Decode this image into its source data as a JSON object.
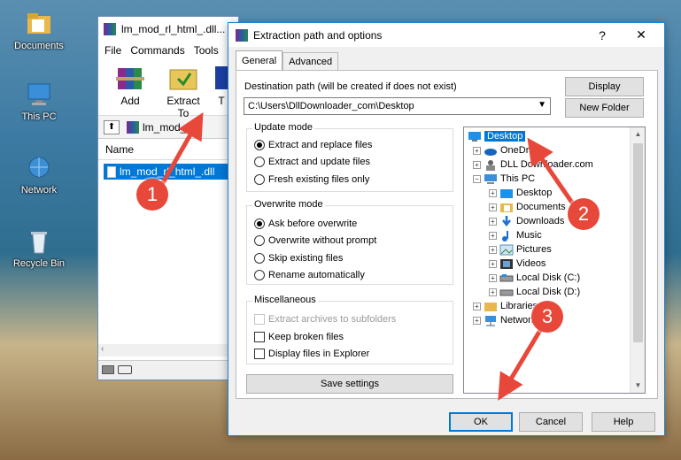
{
  "desktop": {
    "icons": [
      {
        "label": "Documents"
      },
      {
        "label": "This PC"
      },
      {
        "label": "Network"
      },
      {
        "label": "Recycle Bin"
      }
    ]
  },
  "winrar": {
    "title": "lm_mod_rl_html_.dll...",
    "menu": [
      "File",
      "Commands",
      "Tools"
    ],
    "toolbar": {
      "add": "Add",
      "extract_to": "Extract To",
      "third": "T"
    },
    "address": "lm_mod_rl_",
    "list_header": "Name",
    "file_row": "lm_mod_rl_html_.dll"
  },
  "dialog": {
    "title": "Extraction path and options",
    "help": "?",
    "close": "✕",
    "tabs": [
      "General",
      "Advanced"
    ],
    "dest_label": "Destination path (will be created if does not exist)",
    "dest_value": "C:\\Users\\DllDownloader_com\\Desktop",
    "display_btn": "Display",
    "new_folder_btn": "New Folder",
    "update_mode": {
      "title": "Update mode",
      "options": [
        "Extract and replace files",
        "Extract and update files",
        "Fresh existing files only"
      ],
      "selected": 0
    },
    "overwrite_mode": {
      "title": "Overwrite mode",
      "options": [
        "Ask before overwrite",
        "Overwrite without prompt",
        "Skip existing files",
        "Rename automatically"
      ],
      "selected": 0
    },
    "misc": {
      "title": "Miscellaneous",
      "options": [
        "Extract archives to subfolders",
        "Keep broken files",
        "Display files in Explorer"
      ]
    },
    "save_settings": "Save settings",
    "tree": [
      {
        "label": "Desktop",
        "selected": true
      },
      {
        "label": "OneDrive"
      },
      {
        "label": "DLL Downloader.com"
      },
      {
        "label": "This PC"
      },
      {
        "label": "Desktop"
      },
      {
        "label": "Documents"
      },
      {
        "label": "Downloads"
      },
      {
        "label": "Music"
      },
      {
        "label": "Pictures"
      },
      {
        "label": "Videos"
      },
      {
        "label": "Local Disk (C:)"
      },
      {
        "label": "Local Disk (D:)"
      },
      {
        "label": "Libraries"
      },
      {
        "label": "Network"
      }
    ],
    "ok": "OK",
    "cancel": "Cancel",
    "help_btn": "Help"
  },
  "annotations": [
    "1",
    "2",
    "3"
  ],
  "colors": {
    "accent": "#0078d7",
    "annotation": "#e8483a"
  }
}
